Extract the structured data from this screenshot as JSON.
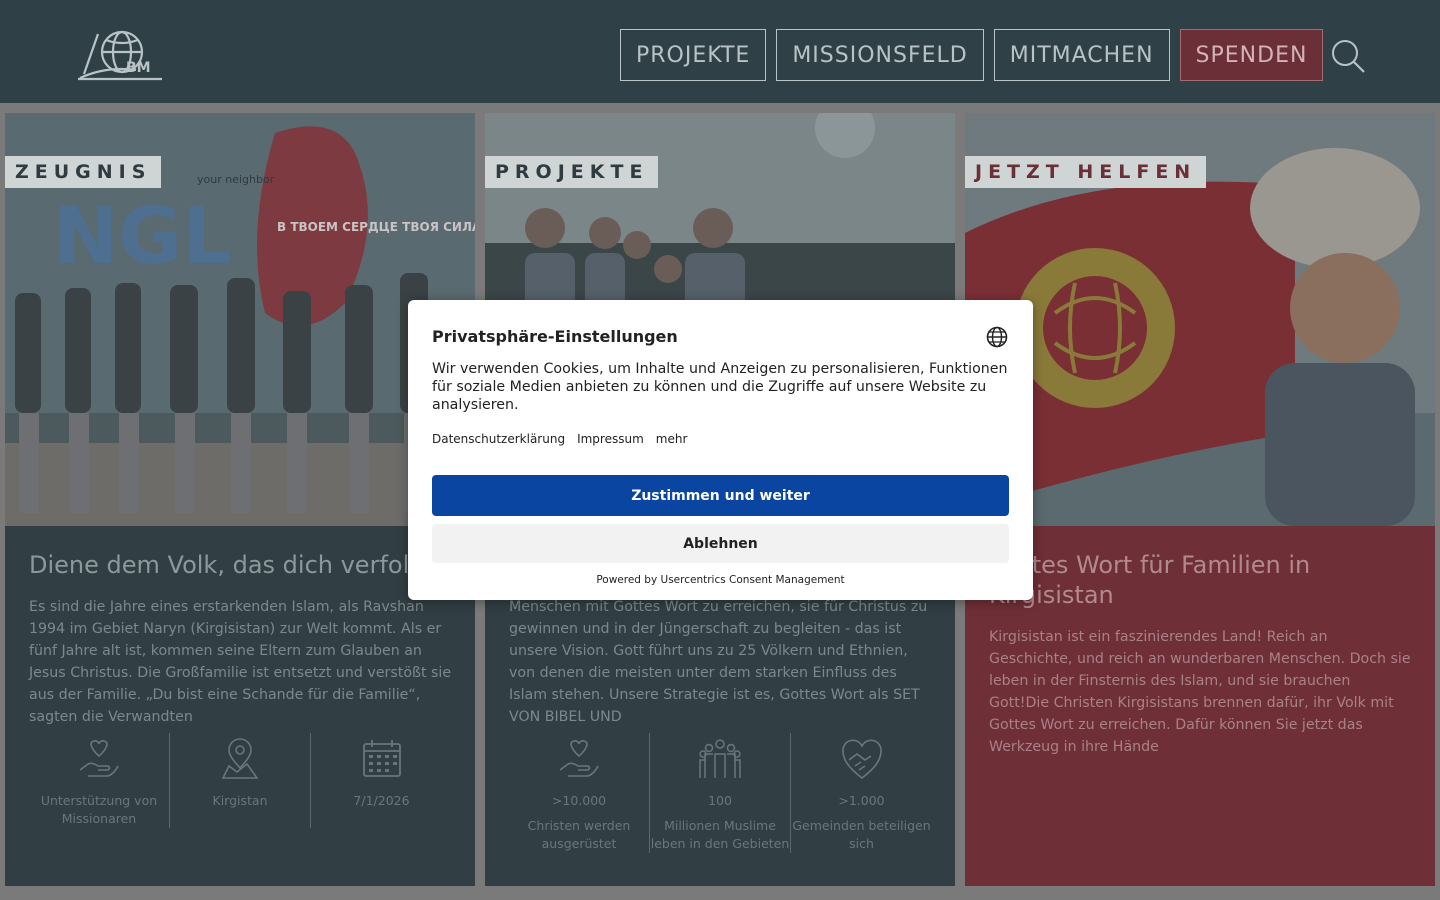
{
  "header": {
    "logo_text": "BM",
    "nav": [
      "PROJEKTE",
      "MISSIONSFELD",
      "MITMACHEN",
      "SPENDEN"
    ]
  },
  "cards": [
    {
      "tag": "ZEUGNIS",
      "image_text": {
        "line1": "NGL",
        "line2": "your neighbor",
        "line3": "В ТВОЕМ СЕРДЦЕ ТВОЯ СИЛА"
      },
      "title": "Diene dem Volk, das dich verfolgt",
      "text": "Es sind die Jahre eines erstarkenden Islam, als Ravshan 1994 im Gebiet Naryn (Kirgisistan) zur Welt kommt. Als er fünf Jahre alt ist, kommen seine Eltern zum Glauben an Jesus Christus. Die Großfamilie ist entsetzt und verstößt sie aus der Familie. „Du bist eine Schande für die Familie“, sagten die Verwandten",
      "stats": [
        {
          "icon": "hand-heart-icon",
          "lines": [
            "Unterstützung von Missionaren"
          ]
        },
        {
          "icon": "map-pin-icon",
          "lines": [
            "Kirgistan"
          ]
        },
        {
          "icon": "calendar-icon",
          "lines": [
            "7/1/2026"
          ]
        }
      ]
    },
    {
      "tag": "PROJEKTE",
      "title": "",
      "text": "Menschen mit Gottes Wort zu erreichen, sie für Christus zu gewinnen und in der Jüngerschaft zu begleiten - das ist unsere Vision. Gott führt uns zu 25 Völkern und Ethnien, von denen die meisten unter dem starken Einfluss des Islam stehen. Unsere Strategie ist es, Gottes Wort als SET VON BIBEL UND",
      "stats": [
        {
          "icon": "hand-heart-icon",
          "value": ">10.000",
          "lines": [
            "Christen werden ausgerüstet"
          ]
        },
        {
          "icon": "people-group-icon",
          "value": "100",
          "lines": [
            "Millionen Muslime leben in den Gebieten"
          ]
        },
        {
          "icon": "handshake-heart-icon",
          "value": ">1.000",
          "lines": [
            "Gemeinden beteiligen sich"
          ]
        }
      ]
    },
    {
      "tag": "JETZT HELFEN",
      "title": "Gottes Wort für Familien in Kirgisistan",
      "text": "Kirgisistan ist ein faszinierendes Land! Reich an Geschichte, und reich an wunderbaren Menschen. Doch sie leben in der Finsternis des Islam, und sie brauchen Gott!Die Christen Kirgisistans brennen dafür, ihr Volk mit Gottes Wort zu erreichen. Dafür können Sie jetzt das Werkzeug in ihre Hände"
    }
  ],
  "dialog": {
    "title": "Privatsphäre-Einstellungen",
    "text": "Wir verwenden Cookies, um Inhalte und Anzeigen zu personalisieren, Funktionen für soziale Medien anbieten zu können und die Zugriffe auf unsere Website zu analysieren.",
    "links": [
      "Datenschutzerklärung",
      "Impressum",
      "mehr"
    ],
    "accept_label": "Zustimmen und weiter",
    "deny_label": "Ablehnen",
    "powered_by": "Powered by Usercentrics Consent Management"
  },
  "colors": {
    "header_bg": "#2f4147",
    "card_bg": "#313f44",
    "donate_bg": "#6b2f37",
    "accept_bg": "#0b45a2"
  }
}
